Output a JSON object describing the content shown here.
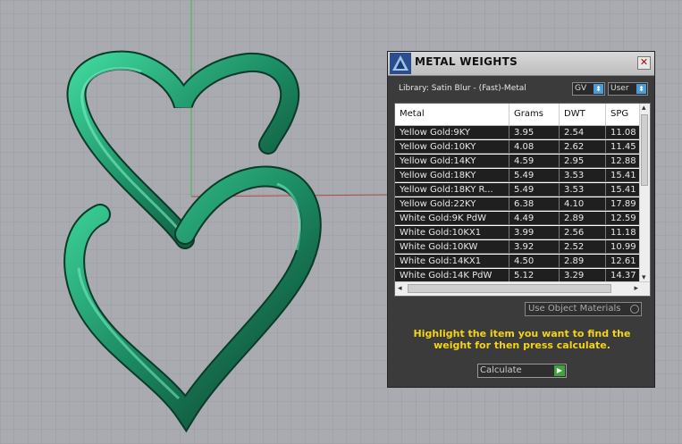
{
  "window": {
    "title": "METAL WEIGHTS",
    "close_glyph": "✕"
  },
  "library": {
    "label": "Library: Satin Blur - (Fast)-Metal",
    "gv_value": "GV",
    "user_value": "User",
    "arrow_glyph": "⬍"
  },
  "table": {
    "columns": [
      "Metal",
      "Grams",
      "DWT",
      "SPG"
    ],
    "rows": [
      [
        "Yellow Gold:9KY",
        "3.95",
        "2.54",
        "11.08"
      ],
      [
        "Yellow Gold:10KY",
        "4.08",
        "2.62",
        "11.45"
      ],
      [
        "Yellow Gold:14KY",
        "4.59",
        "2.95",
        "12.88"
      ],
      [
        "Yellow Gold:18KY",
        "5.49",
        "3.53",
        "15.41"
      ],
      [
        "Yellow Gold:18KY R...",
        "5.49",
        "3.53",
        "15.41"
      ],
      [
        "Yellow Gold:22KY",
        "6.38",
        "4.10",
        "17.89"
      ],
      [
        "White Gold:9K PdW",
        "4.49",
        "2.89",
        "12.59"
      ],
      [
        "White Gold:10KX1",
        "3.99",
        "2.56",
        "11.18"
      ],
      [
        "White Gold:10KW",
        "3.92",
        "2.52",
        "10.99"
      ],
      [
        "White Gold:14KX1",
        "4.50",
        "2.89",
        "12.61"
      ],
      [
        "White Gold:14K PdW",
        "5.12",
        "3.29",
        "14.37"
      ]
    ]
  },
  "use_object_materials": {
    "label": "Use Object Materials",
    "checked": false
  },
  "instructions": "Highlight the item you want to find the weight for then press calculate.",
  "calculate": {
    "label": "Calculate",
    "play_glyph": "▶"
  },
  "colors": {
    "viewport_bg": "#a9abb0",
    "grid_line": "#9c9ea3",
    "axis_green": "#3cb84a",
    "axis_red": "#c0504d",
    "hearts": "#1f8a63",
    "instructions_text": "#f5d316"
  },
  "icons": [
    "app-logo-icon",
    "close-icon",
    "dropdown-arrow-icon",
    "scroll-up-arrow-icon",
    "scroll-down-arrow-icon",
    "scroll-left-arrow-icon",
    "scroll-right-arrow-icon",
    "radio-icon",
    "play-icon"
  ]
}
